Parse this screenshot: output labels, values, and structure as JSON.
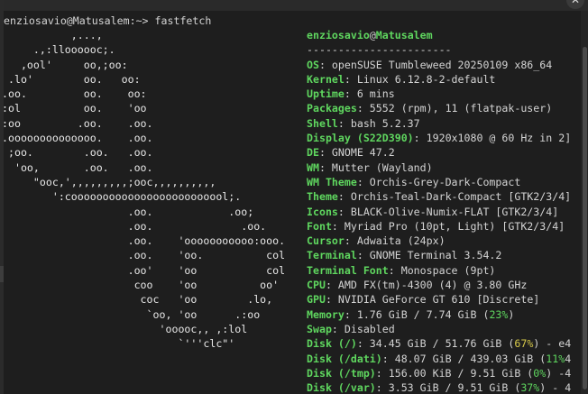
{
  "prompt": "enziosavio@Matusalem:~> fastfetch",
  "logo_lines": [
    "           ,...,",
    "     .,:lloooooc;.",
    "   ,ool'     oo,;oo:",
    " .lo'        oo.   oo:",
    ".oo.         oo.    oo:",
    ":ol          oo.    'oo",
    ":oo         .oo.    .oo.",
    ".oooooooooooooo.    .oo.",
    " ;oo.        .oo.   .oo.",
    "  'oo,       .oo.   .oo.",
    "     \"ooc,',,,,,,,,,;ooc,,,,,,,,,,",
    "        ':cooooooooooooooooooooooool;.",
    "                    .oo.            .oo;",
    "                    .oo.              .oo.",
    "                    .oo.    'ooooooooooo:ooo.",
    "                    .oo.    'oo.          col",
    "                    .oo'    'oo           col",
    "                     coo    'oo          oo'",
    "                      coc   'oo        .lo,",
    "                       `oo, 'oo      .:oo",
    "                         'ooooc,, ,:lol",
    "                            `'''clc\"'"
  ],
  "user": "enziosavio",
  "at": "@",
  "host": "Matusalem",
  "separator": "-----------------------",
  "info": [
    {
      "key": "OS",
      "value": ": openSUSE Tumbleweed 20250109 x86_64"
    },
    {
      "key": "Kernel",
      "value": ": Linux 6.12.8-2-default"
    },
    {
      "key": "Uptime",
      "value": ": 6 mins"
    },
    {
      "key": "Packages",
      "value": ": 5552 (rpm), 11 (flatpak-user)"
    },
    {
      "key": "Shell",
      "value": ": bash 5.2.37"
    },
    {
      "key": "Display (S22D390)",
      "value": ": 1920x1080 @ 60 Hz in 2]"
    },
    {
      "key": "DE",
      "value": ": GNOME 47.2"
    },
    {
      "key": "WM",
      "value": ": Mutter (Wayland)"
    },
    {
      "key": "WM Theme",
      "value": ": Orchis-Grey-Dark-Compact"
    },
    {
      "key": "Theme",
      "value": ": Orchis-Teal-Dark-Compact [GTK2/3/4]"
    },
    {
      "key": "Icons",
      "value": ": BLACK-Olive-Numix-FLAT [GTK2/3/4]"
    },
    {
      "key": "Font",
      "value": ": Myriad Pro (10pt, Light) [GTK2/3/4]"
    },
    {
      "key": "Cursor",
      "value": ": Adwaita (24px)"
    },
    {
      "key": "Terminal",
      "value": ": GNOME Terminal 3.54.2"
    },
    {
      "key": "Terminal Font",
      "value": ": Monospace (9pt)"
    },
    {
      "key": "CPU",
      "value": ": AMD FX(tm)-4300 (4) @ 3.80 GHz"
    },
    {
      "key": "GPU",
      "value": ": NVIDIA GeForce GT 610 [Discrete]"
    }
  ],
  "memory": {
    "key": "Memory",
    "value": ": 1.76 GiB / 7.74 GiB (",
    "pct": "23%",
    "tail": ")"
  },
  "swap": {
    "key": "Swap",
    "value": ": Disabled"
  },
  "disks": [
    {
      "key": "Disk (/)",
      "value": ": 34.45 GiB / 51.76 GiB (",
      "pct": "67%",
      "tail": ") - e4",
      "pct_color": "yellow"
    },
    {
      "key": "Disk (/dati)",
      "value": ": 48.07 GiB / 439.03 GiB (",
      "pct": "11%",
      "tail": "4",
      "pct_color": "green"
    },
    {
      "key": "Disk (/tmp)",
      "value": ": 156.00 KiB / 9.51 GiB (",
      "pct": "0%",
      "tail": ") -4",
      "pct_color": "green"
    },
    {
      "key": "Disk (/var)",
      "value": ": 3.53 GiB / 9.51 GiB (",
      "pct": "37%",
      "tail": ") - 4",
      "pct_color": "green"
    }
  ],
  "colors": {
    "background": "#1e1e1e",
    "accent_green": "#5fd75f",
    "warn_yellow": "#d7c94a",
    "text": "#d4d4d4"
  },
  "icons": {
    "close": "close-icon"
  }
}
